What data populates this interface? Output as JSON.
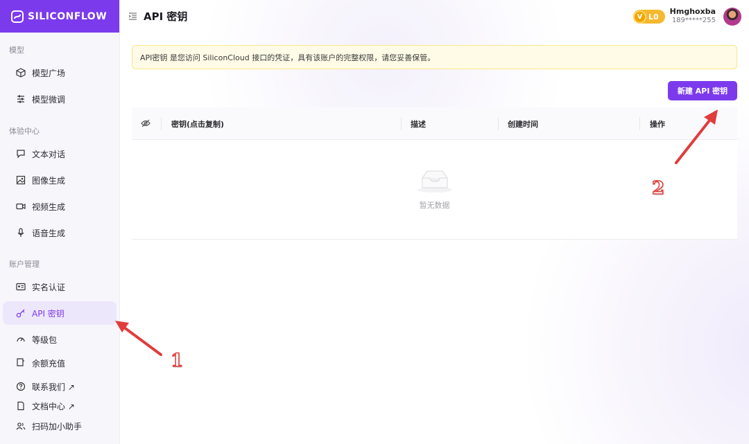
{
  "brand": {
    "name": "SILICONFLOW"
  },
  "sidebar": {
    "sections": [
      {
        "label": "模型"
      },
      {
        "label": "体验中心"
      },
      {
        "label": "账户管理"
      }
    ],
    "items": [
      {
        "label": "模型广场",
        "icon": "cube-icon"
      },
      {
        "label": "模型微调",
        "icon": "sliders-icon"
      },
      {
        "label": "文本对话",
        "icon": "chat-icon"
      },
      {
        "label": "图像生成",
        "icon": "image-icon"
      },
      {
        "label": "视频生成",
        "icon": "video-icon"
      },
      {
        "label": "语音生成",
        "icon": "microphone-icon"
      },
      {
        "label": "实名认证",
        "icon": "id-card-icon"
      },
      {
        "label": "API 密钥",
        "icon": "key-icon",
        "active": true
      },
      {
        "label": "等级包",
        "icon": "gauge-icon"
      },
      {
        "label": "余额充值",
        "icon": "wallet-icon"
      }
    ],
    "footer_links": [
      {
        "label": "联系我们 ↗",
        "icon": "help-circle-icon"
      },
      {
        "label": "文档中心 ↗",
        "icon": "document-icon"
      },
      {
        "label": "扫码加小助手",
        "icon": "users-icon"
      }
    ]
  },
  "header": {
    "title": "API 密钥",
    "vip": {
      "badge": "V",
      "level": "L0"
    },
    "user": {
      "name": "Hmghoxba",
      "phone": "189*****255"
    }
  },
  "notice": {
    "text": "API密钥 是您访问 SiliconCloud 接口的凭证，具有该账户的完整权限，请您妥善保管。"
  },
  "actions": {
    "new_key_label": "新建 API 密钥"
  },
  "table": {
    "columns": [
      "密钥(点击复制)",
      "描述",
      "创建时间",
      "操作"
    ],
    "rows": [],
    "empty_text": "暂无数据"
  },
  "annotations": {
    "step1": "1",
    "step2": "2"
  },
  "colors": {
    "accent": "#7c3aed",
    "notice_bg": "#fffbe6",
    "arrow": "#e03c3c"
  }
}
